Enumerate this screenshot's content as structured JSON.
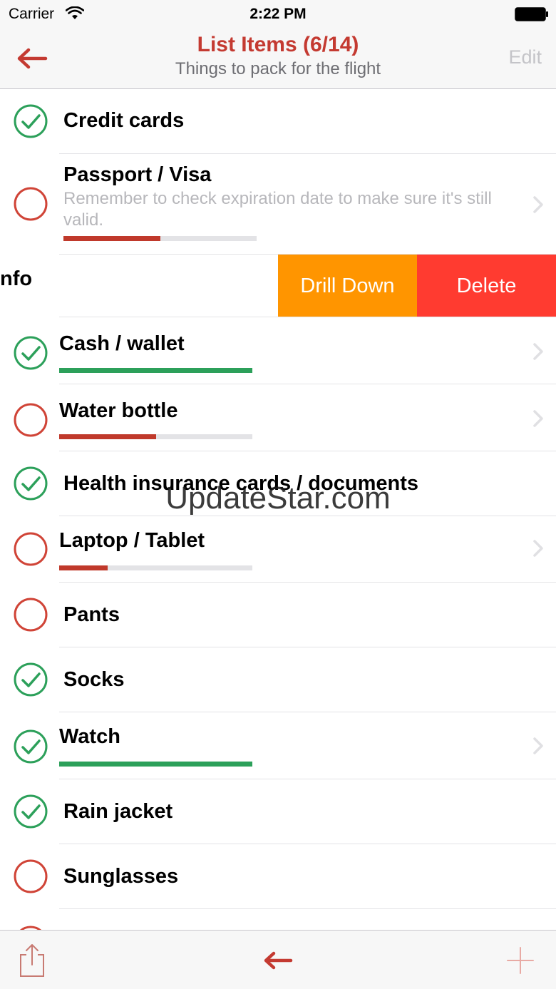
{
  "status": {
    "carrier": "Carrier",
    "time": "2:22 PM"
  },
  "nav": {
    "title": "List Items (6/14)",
    "subtitle": "Things to pack for the flight",
    "edit_label": "Edit"
  },
  "colors": {
    "accent": "#c43a31",
    "done": "#2ca05a",
    "todo": "#d04437",
    "drill": "#ff9500",
    "delete": "#ff3b30"
  },
  "swipe_row": {
    "visible_label": "nfo",
    "drill_label": "Drill Down",
    "delete_label": "Delete"
  },
  "items": [
    {
      "label": "Credit cards",
      "checked": true
    },
    {
      "label": "Passport / Visa",
      "checked": false,
      "note": "Remember to check expiration date to make sure it's still valid.",
      "progress": 0.5,
      "chevron": true
    },
    {
      "label": "Cash / wallet",
      "checked": true,
      "progress": 1.0,
      "chevron": true
    },
    {
      "label": "Water bottle",
      "checked": false,
      "progress": 0.5,
      "chevron": true
    },
    {
      "label": "Health insurance cards / documents",
      "checked": true
    },
    {
      "label": "Laptop / Tablet",
      "checked": false,
      "progress": 0.25,
      "chevron": true
    },
    {
      "label": "Pants",
      "checked": false
    },
    {
      "label": "Socks",
      "checked": true
    },
    {
      "label": "Watch",
      "checked": true,
      "progress": 1.0,
      "chevron": true
    },
    {
      "label": "Rain jacket",
      "checked": true
    },
    {
      "label": "Sunglasses",
      "checked": false
    }
  ],
  "watermark": "UpdateStar.com",
  "toolbar": {
    "share_icon": "share-icon",
    "back_icon": "back-arrow-icon",
    "add_icon": "plus-icon"
  }
}
